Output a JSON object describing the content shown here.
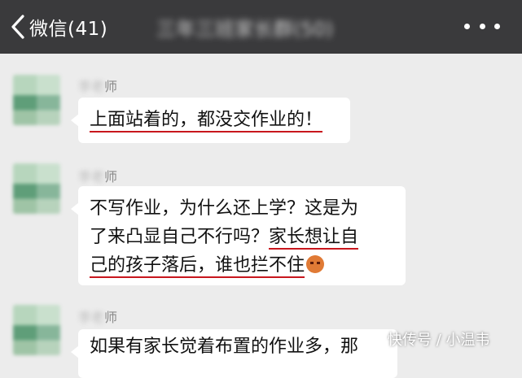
{
  "header": {
    "back_label": "微信(41)",
    "title_blurred": "三年三班家长群(50)"
  },
  "messages": [
    {
      "sender_blurred": "李老",
      "sender_suffix": "师",
      "text_underlined": "上面站着的，都没交作业的！"
    },
    {
      "sender_blurred": "李老",
      "sender_suffix": "师",
      "line1": "不写作业，为什么还上学？这是为",
      "line2_plain": "了来凸显自己不行吗？",
      "line2_underlined": "家长想让自",
      "line3_underlined": "己的孩子落后，谁也拦不住",
      "emoji": "angry-face-emoji"
    },
    {
      "sender_blurred": "李老",
      "sender_suffix": "师",
      "text": "如果有家长觉着布置的作业多，那"
    }
  ],
  "watermark": "快传号 / 小温韦"
}
